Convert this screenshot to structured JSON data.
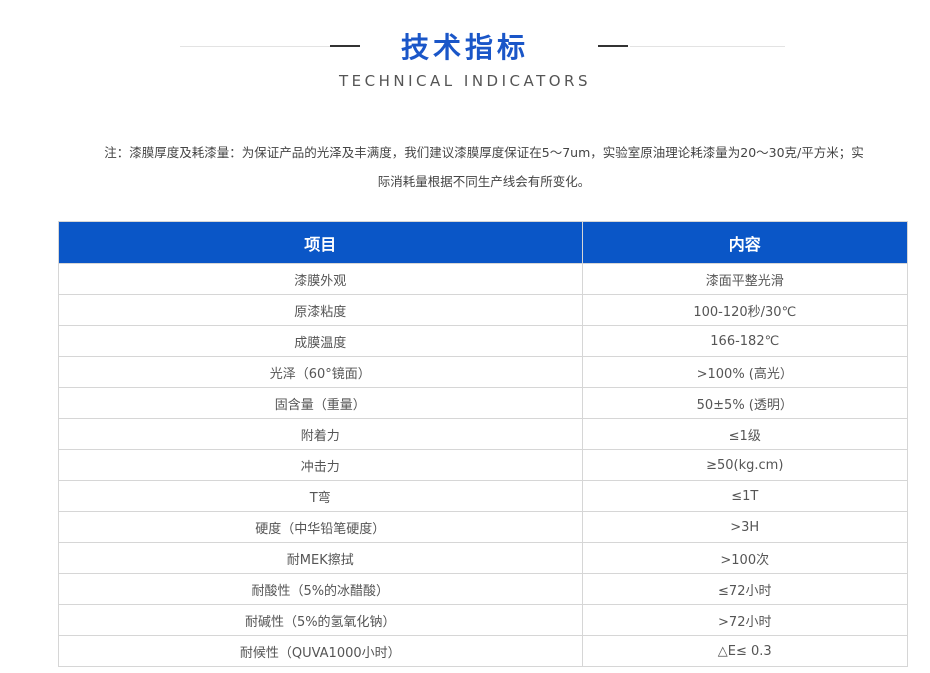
{
  "header": {
    "title_cn": "技术指标",
    "title_en": "TECHNICAL INDICATORS"
  },
  "note": {
    "line1": "注：漆膜厚度及耗漆量：为保证产品的光泽及丰满度，我们建议漆膜厚度保证在5～7um，实验室原油理论耗漆量为20～30克/平方米；实",
    "line2": "际消耗量根据不同生产线会有所变化。"
  },
  "table": {
    "headers": [
      "项目",
      "内容"
    ],
    "rows": [
      [
        "漆膜外观",
        "漆面平整光滑"
      ],
      [
        "原漆粘度",
        "100-120秒/30℃"
      ],
      [
        "成膜温度",
        "166-182℃"
      ],
      [
        "光泽（60°镜面）",
        ">100% (高光）"
      ],
      [
        "固含量（重量）",
        "50±5% (透明）"
      ],
      [
        "附着力",
        "≤1级"
      ],
      [
        "冲击力",
        "≥50(kg.cm)"
      ],
      [
        "T弯",
        "≤1T"
      ],
      [
        "硬度（中华铅笔硬度）",
        ">3H"
      ],
      [
        "耐MEK擦拭",
        ">100次"
      ],
      [
        "耐酸性（5%的冰醋酸）",
        "≤72小时"
      ],
      [
        "耐碱性（5%的氢氧化钠）",
        ">72小时"
      ],
      [
        "耐候性（QUVA1000小时）",
        "△E≤ 0.3"
      ]
    ]
  },
  "colors": {
    "accent": "#1a56c8",
    "header_bg": "#0a56c7"
  }
}
